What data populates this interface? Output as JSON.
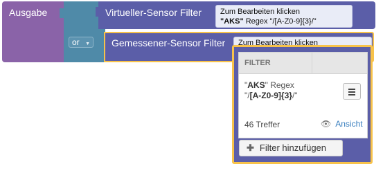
{
  "output_block": {
    "label": "Ausgabe"
  },
  "or_block": {
    "operator": "or"
  },
  "virtual_sensor": {
    "title": "Virtueller-Sensor Filter",
    "field_line1": "Zum Bearbeiten klicken",
    "field_line2_quote": "\"AKS\"",
    "field_line2_rest": " Regex \"/[A-Z0-9]{3}/\""
  },
  "measured_sensor": {
    "title": "Gemessener-Sensor Filter",
    "field_text": "Zum Bearbeiten klicken"
  },
  "popup": {
    "column_header": "FILTER",
    "regex_quote_open": "\"",
    "regex_key": "AKS",
    "regex_mid": "\" Regex",
    "regex_line2_open": "\"/",
    "regex_pattern": "[A-Z0-9]{3}",
    "regex_line2_close": "/\"",
    "hits": "46 Treffer",
    "view_label": "Ansicht",
    "add_filter_label": "Filter hinzufügen"
  },
  "colors": {
    "output_block": "#8a63a8",
    "or_block": "#4f8aa8",
    "sensor_block": "#5b5ea8",
    "highlight": "#f7c24a",
    "link": "#3a7fbf"
  },
  "icons": [
    "chevron-down-icon",
    "hamburger-menu-icon",
    "eye-icon",
    "plus-icon"
  ]
}
